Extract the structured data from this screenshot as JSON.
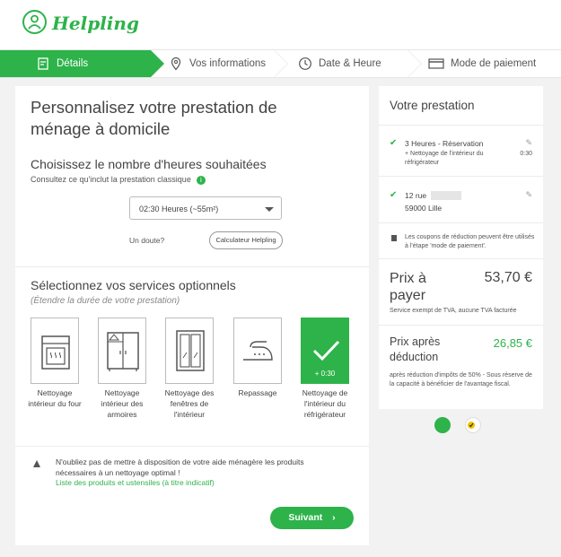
{
  "brand": {
    "name": "Helpling",
    "accent": "#2db34a"
  },
  "steps": [
    {
      "label": "Détails",
      "icon": "clipboard-icon",
      "active": true
    },
    {
      "label": "Vos informations",
      "icon": "location-pin-icon",
      "active": false
    },
    {
      "label": "Date & Heure",
      "icon": "clock-icon",
      "active": false
    },
    {
      "label": "Mode de paiement",
      "icon": "credit-card-icon",
      "active": false
    }
  ],
  "main": {
    "title": "Personnalisez votre prestation de ménage à domicile",
    "hours_title": "Choisissez le nombre d'heures souhaitées",
    "hours_sub": "Consultez ce qu'inclut la prestation classique",
    "hours_select": "02:30 Heures (~55m²)",
    "doubt": "Un doute?",
    "calc_button": "Calculateur Helpling",
    "options_title": "Sélectionnez vos services optionnels",
    "options_sub": "(Étendre la durée de votre prestation)",
    "services": [
      {
        "label": "Nettoyage intérieur du four",
        "icon": "oven-icon"
      },
      {
        "label": "Nettoyage intérieur des armoires",
        "icon": "wardrobe-icon"
      },
      {
        "label": "Nettoyage des fenêtres de l'intérieur",
        "icon": "window-icon"
      },
      {
        "label": "Repassage",
        "icon": "iron-icon"
      },
      {
        "label": "Nettoyage de l'intérieur du réfrigérateur",
        "icon": "check-icon",
        "extra": "+ 0:30",
        "selected": true
      }
    ],
    "warning": "N'oubliez pas de mettre à disposition de votre aide ménagère les produits nécessaires à un nettoyage optimal !",
    "warning_link": "Liste des produits et ustensiles (à titre indicatif)",
    "next_button": "Suivant"
  },
  "side": {
    "title": "Votre prestation",
    "service_line": "3 Heures - Réservation",
    "service_extra": "+ Nettoyage de l'intérieur du réfrigérateur",
    "service_extra_time": "0:30",
    "address_line1": "12 rue",
    "address_line2": "59000 Lille",
    "coupon_note": "Les coupons de réduction peuvent être utilisés à l'étape 'mode de paiement'.",
    "price_label": "Prix à payer",
    "price_value": "53,70 €",
    "price_note": "Service exempt de TVA, aucune TVA facturée",
    "deduction_label": "Prix après déduction",
    "deduction_value": "26,85 €",
    "deduction_note": "après réduction d'impôts de 50% - Sous réserve de la capacité à bénéficier de l'avantage fiscal."
  }
}
